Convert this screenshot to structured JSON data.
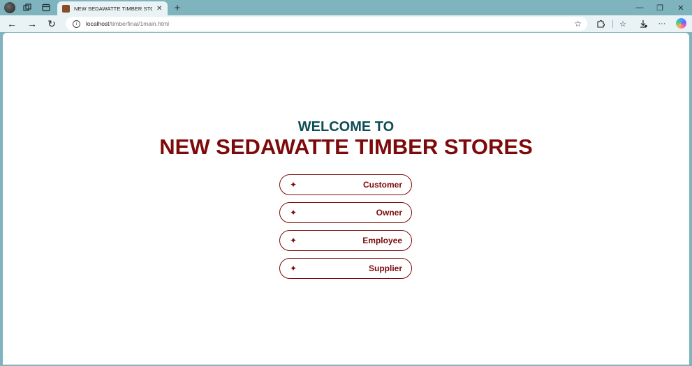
{
  "browser": {
    "tab": {
      "title": "NEW SEDAWATTE TIMBER STORE",
      "close": "✕"
    },
    "new_tab": "+",
    "address": {
      "host": "localhost",
      "path": "/timberfinal/1main.html"
    },
    "window_controls": {
      "minimize": "—",
      "restore": "❐",
      "close": "✕"
    },
    "nav": {
      "back": "←",
      "forward": "→",
      "reload": "↻"
    },
    "more": "···"
  },
  "page": {
    "welcome": "WELCOME TO",
    "store_name": "NEW SEDAWATTE TIMBER STORES",
    "buttons": [
      {
        "icon": "sparkle-icon",
        "label": "Customer"
      },
      {
        "icon": "sparkle-icon",
        "label": "Owner"
      },
      {
        "icon": "sparkle-icon",
        "label": "Employee"
      },
      {
        "icon": "sparkle-icon",
        "label": "Supplier"
      }
    ],
    "sparkle_glyph": "✦"
  },
  "colors": {
    "browser_frame": "#7fb3bd",
    "welcome_text": "#0d4d55",
    "brand_maroon": "#7d0a0a",
    "page_background": "#ffffff"
  }
}
